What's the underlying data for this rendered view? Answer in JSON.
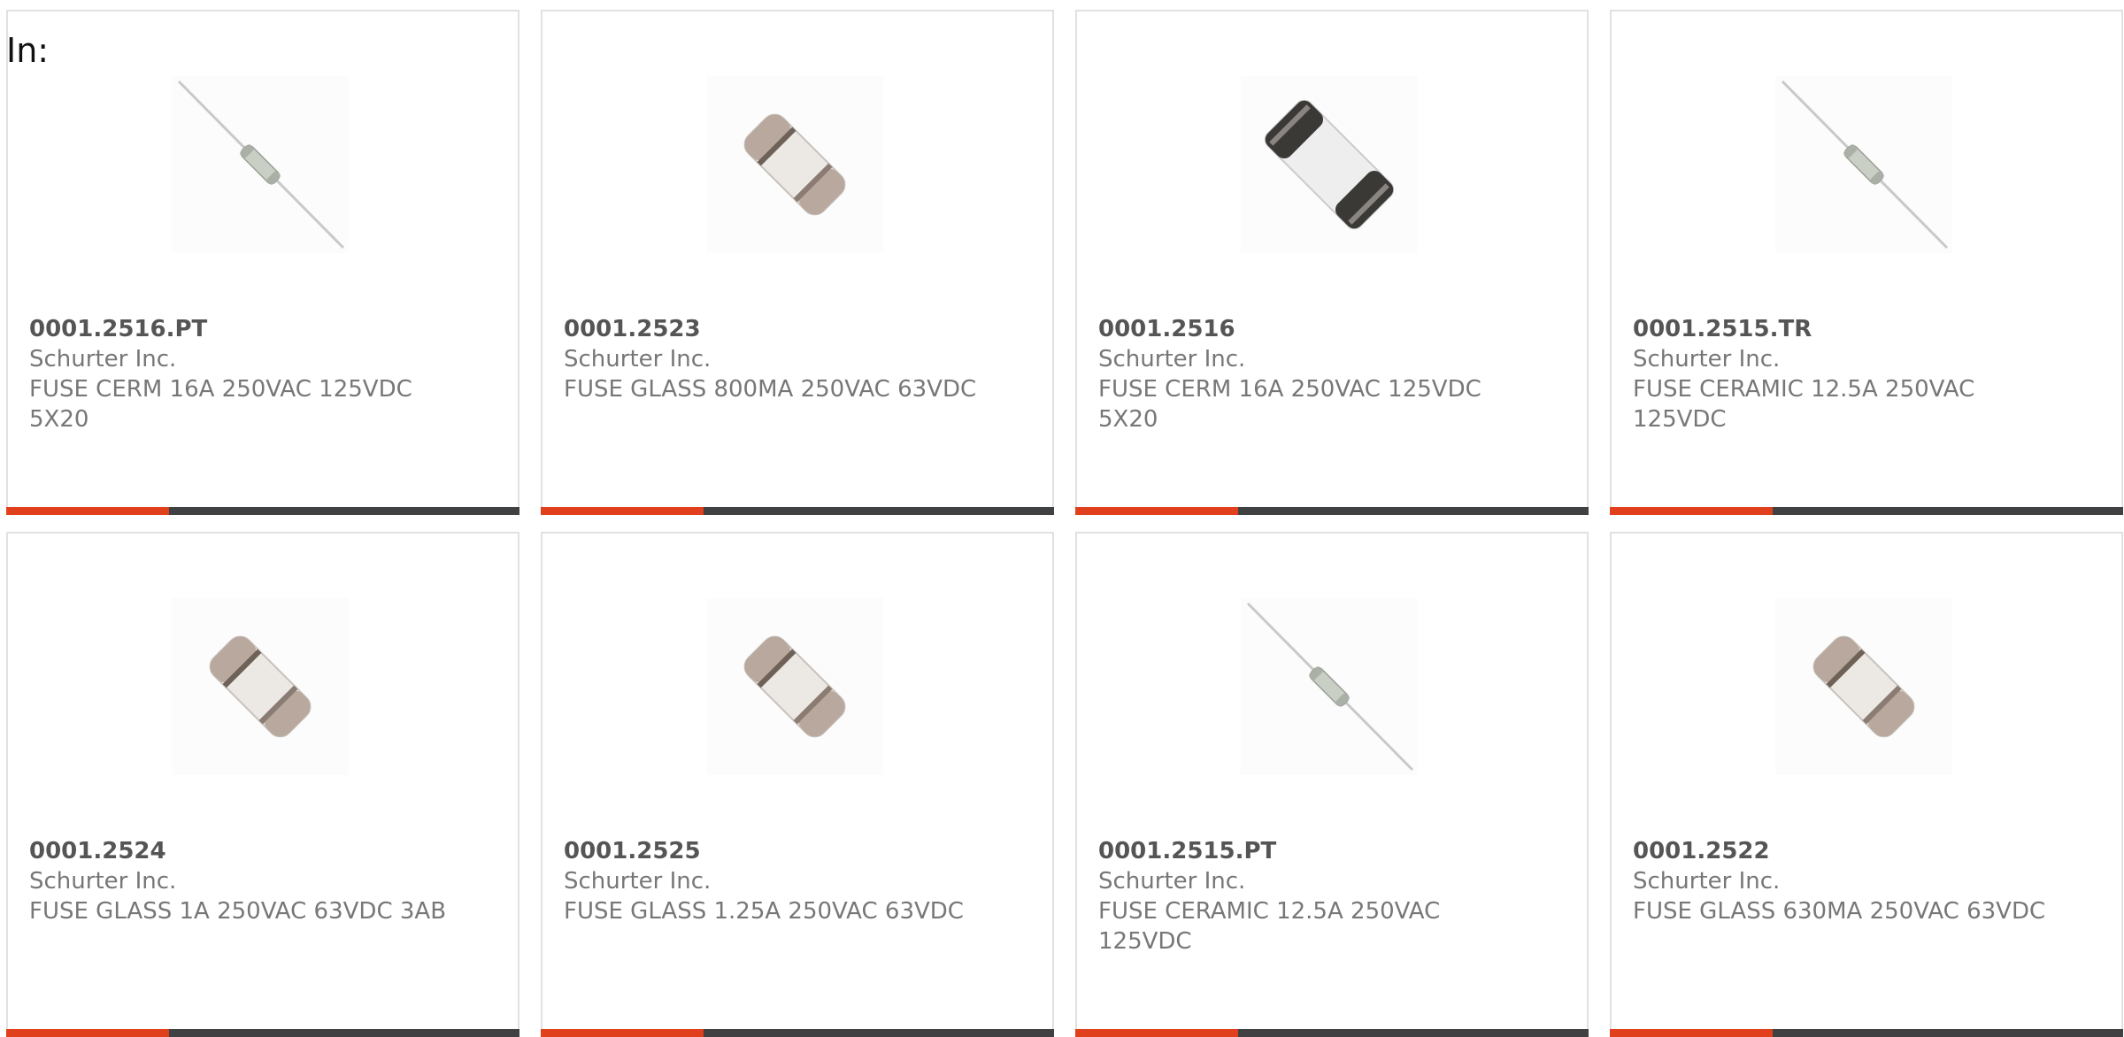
{
  "header": {
    "in_label": "In:"
  },
  "products": [
    {
      "part_number": "0001.2516.PT",
      "manufacturer": "Schurter Inc.",
      "description": "FUSE CERM 16A 250VAC 125VDC 5X20",
      "image": "axial-lead-fuse"
    },
    {
      "part_number": "0001.2523",
      "manufacturer": "Schurter Inc.",
      "description": "FUSE GLASS 800MA 250VAC 63VDC",
      "image": "cartridge-fuse-light"
    },
    {
      "part_number": "0001.2516",
      "manufacturer": "Schurter Inc.",
      "description": "FUSE CERM 16A 250VAC 125VDC 5X20",
      "image": "cartridge-fuse-dark"
    },
    {
      "part_number": "0001.2515.TR",
      "manufacturer": "Schurter Inc.",
      "description": "FUSE CERAMIC 12.5A 250VAC 125VDC",
      "image": "axial-lead-fuse"
    },
    {
      "part_number": "0001.2524",
      "manufacturer": "Schurter Inc.",
      "description": "FUSE GLASS 1A 250VAC 63VDC 3AB",
      "image": "cartridge-fuse-light"
    },
    {
      "part_number": "0001.2525",
      "manufacturer": "Schurter Inc.",
      "description": "FUSE GLASS 1.25A 250VAC 63VDC",
      "image": "cartridge-fuse-light"
    },
    {
      "part_number": "0001.2515.PT",
      "manufacturer": "Schurter Inc.",
      "description": "FUSE CERAMIC 12.5A 250VAC 125VDC",
      "image": "axial-lead-fuse"
    },
    {
      "part_number": "0001.2522",
      "manufacturer": "Schurter Inc.",
      "description": "FUSE GLASS 630MA 250VAC 63VDC",
      "image": "cartridge-fuse-light"
    }
  ],
  "colors": {
    "accent_bar": "#e0401b",
    "dark_bar": "#3f4142",
    "card_border": "#e1e1e1",
    "text_muted": "#777777",
    "text_part_number": "#555555"
  }
}
